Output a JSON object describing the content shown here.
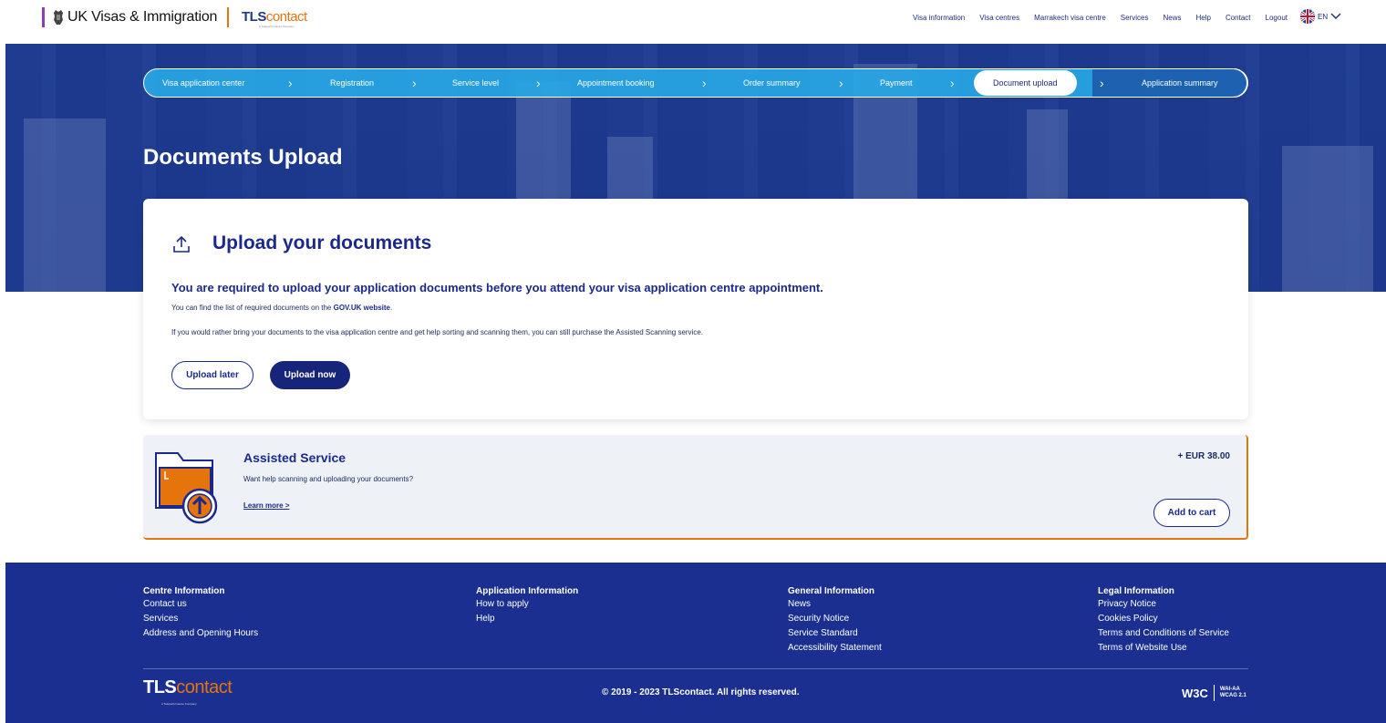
{
  "header": {
    "ukvi": "UK Visas & Immigration",
    "tls_brand_main": "TLS",
    "tls_brand_contact": "contact",
    "tls_sub": "A Teleperformance Company",
    "nav": [
      "Visa information",
      "Visa centres",
      "Marrakech visa centre",
      "Services",
      "News",
      "Help",
      "Contact",
      "Logout"
    ],
    "lang": "EN"
  },
  "stepper": {
    "steps": [
      "Visa application center",
      "Registration",
      "Service level",
      "Appointment booking",
      "Order summary",
      "Payment",
      "Document upload",
      "Application summary"
    ],
    "current_index": 6
  },
  "page_title": "Documents Upload",
  "upload_card": {
    "title": "Upload your documents",
    "required": "You are required to upload your application documents before you attend your visa application centre appointment.",
    "find_list_prefix": "You can find the list of required documents on the ",
    "find_list_link": "GOV.UK website",
    "find_list_suffix": ".",
    "rather": "If you would rather bring your documents to the visa application centre and get help sorting and scanning them, you can still purchase the Assisted Scanning service.",
    "upload_later": "Upload later",
    "upload_now": "Upload now"
  },
  "assisted": {
    "title": "Assisted Service",
    "desc": "Want help scanning and uploading your documents?",
    "learn_more": "Learn more >",
    "price": "+ EUR 38.00",
    "add_to_cart": "Add to cart"
  },
  "footer": {
    "col1": {
      "heading": "Centre Information",
      "links": [
        "Contact us",
        "Services",
        "Address and Opening Hours"
      ]
    },
    "col2": {
      "heading": "Application Information",
      "links": [
        "How to apply",
        "Help"
      ]
    },
    "col3": {
      "heading": "General Information",
      "links": [
        "News",
        "Security Notice",
        "Service Standard",
        "Accessibility Statement"
      ]
    },
    "col4": {
      "heading": "Legal Information",
      "links": [
        "Privacy Notice",
        "Cookies Policy",
        "Terms and Conditions of Service",
        "Terms of Website Use"
      ]
    },
    "logo_main": "TLS",
    "logo_contact": "contact",
    "logo_sub": "A Teleperformance Company",
    "copyright": "© 2019 - 2023 TLScontact. All rights reserved.",
    "w3c": "W3C",
    "wcag_line1": "WAI-AA",
    "wcag_line2": "WCAG 2.1"
  },
  "colors": {
    "navy": "#1b2a8a",
    "orange": "#e6740d",
    "stepper_blue": "#28aae6",
    "footer": "#1a2f8f"
  }
}
